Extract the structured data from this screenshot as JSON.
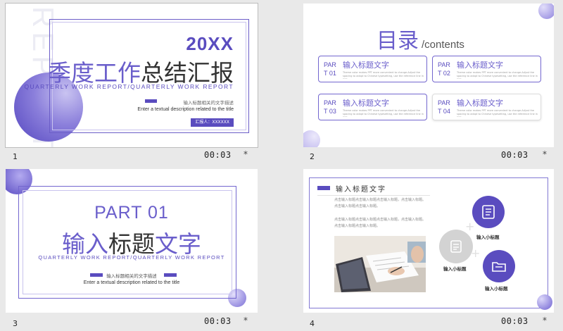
{
  "slides": [
    {
      "number": "1",
      "time": "00:03",
      "star": "*",
      "watermark": "REPORT",
      "year": "20XX",
      "title_part1": "季度工作",
      "title_part2": "总结汇报",
      "subtitle": "QUARTERLY WORK REPORT/QUARTERLY WORK REPORT",
      "desc_cn": "输入标题相关的文字描述",
      "desc_en": "Enter a textual description related to the title",
      "reporter": "汇报人：XXXXXX"
    },
    {
      "number": "2",
      "time": "00:03",
      "star": "*",
      "title": "目录",
      "title_en": "/contents",
      "items": [
        {
          "part": "PART 01",
          "heading": "输入标题文字",
          "text": "Theme color makes PPT more convenient to change.Adjust the spacing to adapt to Chinese typesetting, use the reference line in PPT."
        },
        {
          "part": "PART 02",
          "heading": "输入标题文字",
          "text": "Theme color makes PPT more convenient to change.Adjust the spacing to adapt to Chinese typesetting, use the reference line in PPT."
        },
        {
          "part": "PART 03",
          "heading": "输入标题文字",
          "text": "Theme color makes PPT more convenient to change.Adjust the spacing to adapt to Chinese typesetting, use the reference line in PPT."
        },
        {
          "part": "PART 04",
          "heading": "输入标题文字",
          "text": "Theme color makes PPT more convenient to change.Adjust the spacing to adapt to Chinese typesetting, use the reference line in PPT."
        }
      ]
    },
    {
      "number": "3",
      "time": "00:03",
      "star": "*",
      "part": "PART 01",
      "title_part1": "输入",
      "title_part2": "标题",
      "title_part3": "文字",
      "subtitle": "QUARTERLY WORK REPORT/QUARTERLY WORK REPORT",
      "desc_cn": "输入标题相关的文字描述",
      "desc_en": "Enter a textual description related to the title"
    },
    {
      "number": "4",
      "time": "00:03",
      "star": "*",
      "heading": "输入标题文字",
      "para1": "点击输入标题点击输入标题点击输入标题，点击输入标题。点击输入标题点击输入标题。",
      "para2": "点击输入标题点击输入标题点击输入标题，点击输入标题。点击输入标题点击输入标题。",
      "label_top": "输入小标题",
      "label_left": "输入小标题",
      "label_bottom": "输入小标题",
      "colors": {
        "accent": "#5a4cbf",
        "gray": "#d0d0d0"
      }
    }
  ]
}
